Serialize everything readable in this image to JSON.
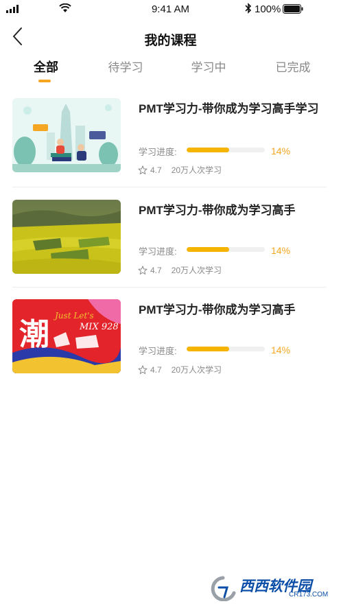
{
  "status_bar": {
    "time": "9:41 AM",
    "battery": "100%",
    "icons": [
      "signal-icon",
      "wifi-icon",
      "bluetooth-icon",
      "battery-icon"
    ]
  },
  "nav": {
    "title": "我的课程",
    "back_icon": "chevron-left-icon"
  },
  "tabs": [
    {
      "label": "全部",
      "active": true
    },
    {
      "label": "待学习",
      "active": false
    },
    {
      "label": "学习中",
      "active": false
    },
    {
      "label": "已完成",
      "active": false
    }
  ],
  "courses": [
    {
      "title": "PMT学习力-带你成为学习高手学习",
      "progress_label": "学习进度:",
      "progress": 0.14,
      "progress_text": "14%",
      "rating": "4.7",
      "learners": "20万人次学习"
    },
    {
      "title": "PMT学习力-带你成为学习高手",
      "progress_label": "学习进度:",
      "progress": 0.14,
      "progress_text": "14%",
      "rating": "4.7",
      "learners": "20万人次学习"
    },
    {
      "title": "PMT学习力-带你成为学习高手",
      "progress_label": "学习进度:",
      "progress": 0.14,
      "progress_text": "14%",
      "rating": "4.7",
      "learners": "20万人次学习",
      "thumbnail_text": {
        "main": "潮",
        "sub": "Just Let's",
        "mix": "MIX 928"
      }
    }
  ],
  "colors": {
    "accent": "#f5a623",
    "progress_fill": "#f5b400",
    "percent_text": "#f5a623",
    "active_tab": "#111111",
    "inactive_tab": "#888888"
  },
  "watermark": {
    "main": "西西软件园",
    "site": "CR173.COM"
  }
}
